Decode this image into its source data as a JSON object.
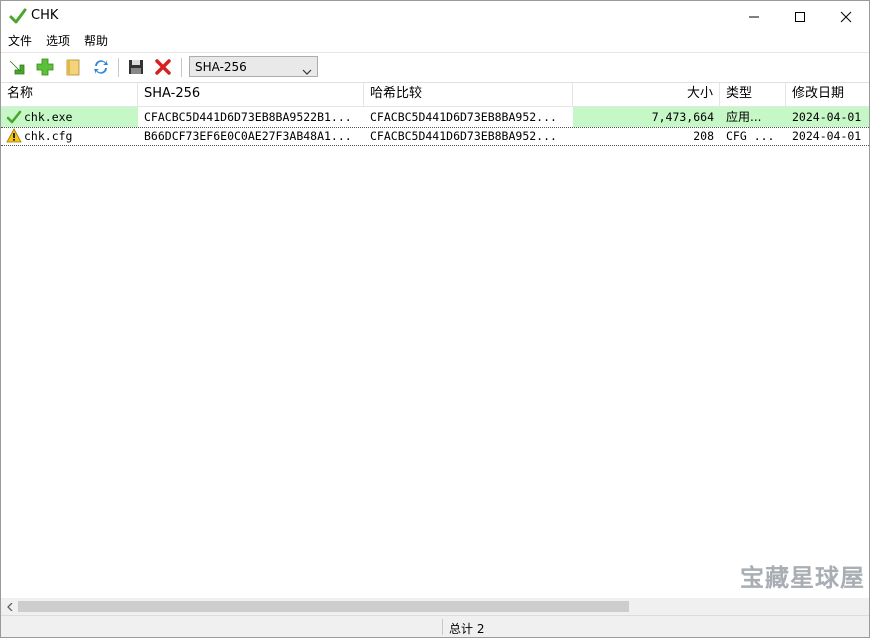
{
  "window": {
    "title": "CHK"
  },
  "menu": {
    "items": [
      "文件",
      "选项",
      "帮助"
    ]
  },
  "toolbar": {
    "hash_algorithm": "SHA-256"
  },
  "columns": [
    {
      "label": "名称"
    },
    {
      "label": "SHA-256"
    },
    {
      "label": "哈希比较"
    },
    {
      "label": "大小"
    },
    {
      "label": "类型"
    },
    {
      "label": "修改日期"
    }
  ],
  "rows": [
    {
      "status_icon": "check-icon",
      "name": "chk.exe",
      "sha": "CFACBC5D441D6D73EB8BA9522B1...",
      "compare": "CFACBC5D441D6D73EB8BA952...",
      "size": "7,473,664",
      "type": "应用...",
      "date": "2024-04-01"
    },
    {
      "status_icon": "warning-icon",
      "name": "chk.cfg",
      "sha": "B66DCF73EF6E0C0AE27F3AB48A1...",
      "compare": "CFACBC5D441D6D73EB8BA952...",
      "size": "208",
      "type": "CFG ...",
      "date": "2024-04-01"
    }
  ],
  "status": {
    "total": "总计 2"
  },
  "watermark": "宝藏星球屋",
  "colors": {
    "match_row": "#c6f7c6"
  }
}
